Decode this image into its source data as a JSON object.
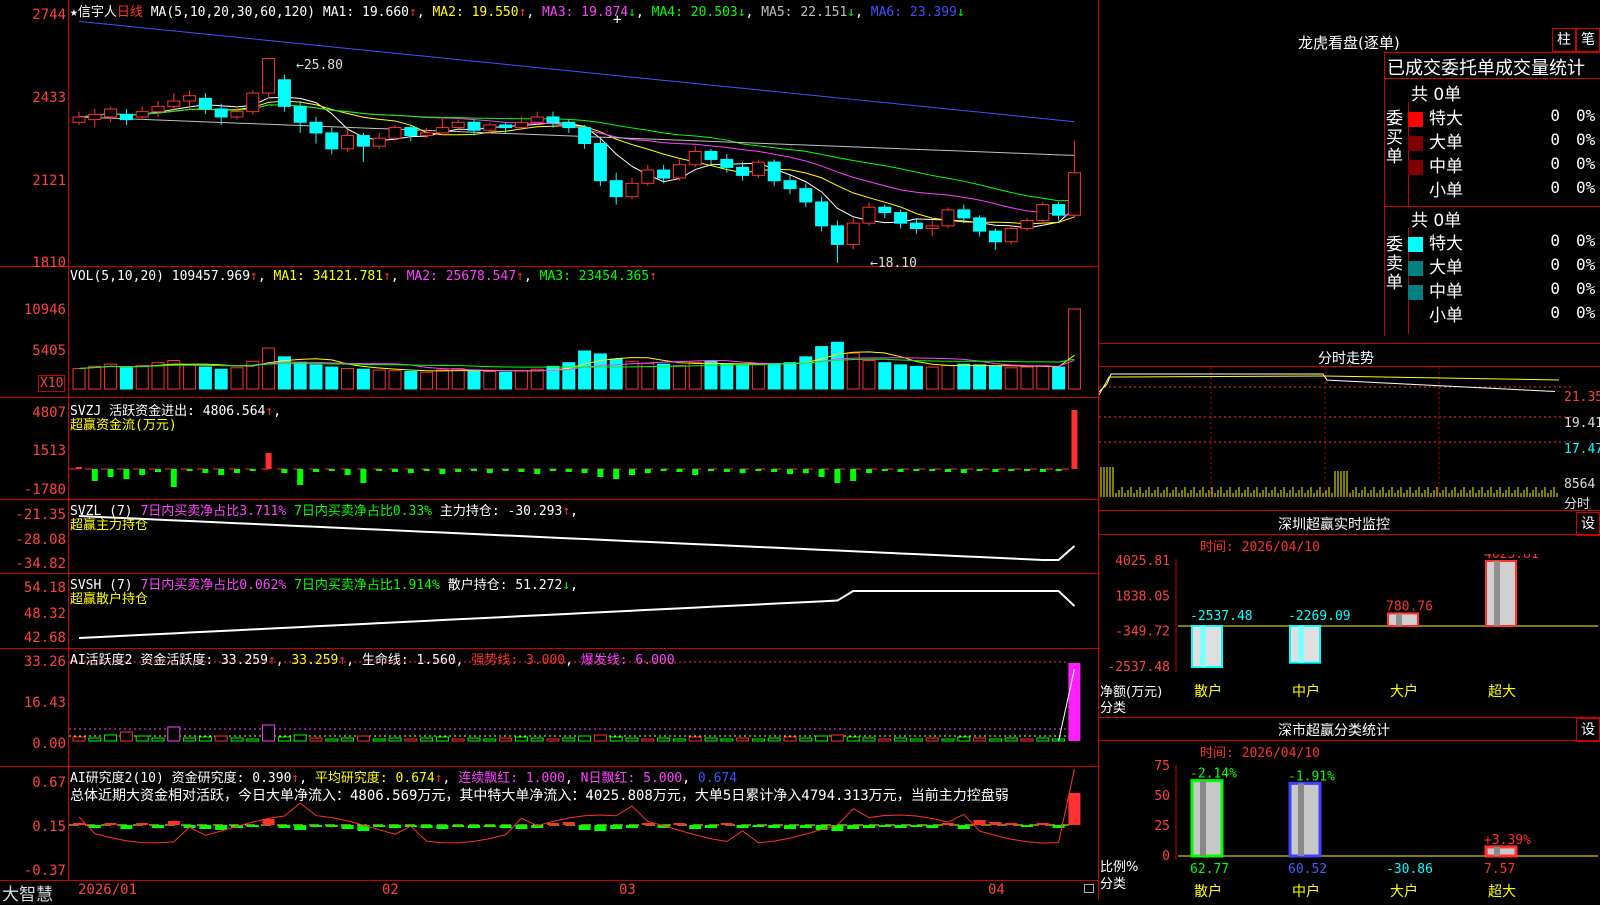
{
  "main": {
    "star": "★",
    "stock_name": "信宇人",
    "period": "日线",
    "ma_params": "MA(5,10,20,30,60,120)",
    "ma": [
      {
        "label": "MA1: 19.660",
        "color": "#ffffff"
      },
      {
        "label": "MA2: 19.550",
        "color": "#ffff00"
      },
      {
        "label": "MA3: 19.874",
        "color": "#ff40ff"
      },
      {
        "label": "MA4: 20.503",
        "color": "#00ff00"
      },
      {
        "label": "MA5: 22.151",
        "color": "#c0c0c0"
      },
      {
        "label": "MA6: 23.399",
        "color": "#4050ff"
      }
    ],
    "y_ticks": [
      "2744",
      "2433",
      "2121",
      "1810"
    ],
    "high_label": "25.80",
    "low_label": "18.10"
  },
  "vol": {
    "params": "VOL(5,10,20)",
    "value": "109457.969",
    "ma1": "MA1: 34121.781",
    "ma2": "MA2: 25678.547",
    "ma3": "MA3: 23454.365",
    "y_ticks": [
      "10946",
      "5405"
    ],
    "unit": "X10"
  },
  "svzj": {
    "name": "SVZJ",
    "label": "活跃资金进出: 4806.564",
    "sub": "超赢资金流(万元)",
    "y_ticks": [
      "4807",
      "1513",
      "-1780"
    ]
  },
  "svzl": {
    "name": "SVZL (7)",
    "a": "7日内买卖净占比3.711%",
    "b": "7日内买卖净占比0.33%",
    "c": "主力持仓: -30.293",
    "sub": "超赢主力持仓",
    "y_ticks": [
      "-21.35",
      "-28.08",
      "-34.82"
    ]
  },
  "svsh": {
    "name": "SVSH (7)",
    "a": "7日内买卖净占比0.062%",
    "b": "7日内买卖净占比1.914%",
    "c": "散户持仓: 51.272",
    "sub": "超赢散户持仓",
    "y_ticks": [
      "54.18",
      "48.32",
      "42.68"
    ]
  },
  "ai1": {
    "name": "AI活跃度2",
    "a": "资金活跃度: 33.259",
    "b": "33.259",
    "c": "生命线: 1.560",
    "d": "强势线: 3.000",
    "e": "爆发线: 6.000",
    "y_ticks": [
      "33.26",
      "16.43",
      "0.00"
    ]
  },
  "ai2": {
    "name": "AI研究度2(10)",
    "a": "资金研究度: 0.390",
    "b": "平均研究度: 0.674",
    "c": "连续飘红: 1.000",
    "d": "N日飘红: 5.000",
    "e": "0.674",
    "summary": "总体近期大资金相对活跃，今日大单净流入：4806.569万元，其中特大单净流入：4025.808万元，大单5日累计净入4794.313万元，当前主力控盘弱",
    "y_ticks": [
      "0.67",
      "0.15",
      "-0.37"
    ]
  },
  "bottom": {
    "brand": "大智慧",
    "months": [
      "2026/01",
      "02",
      "03",
      "04"
    ]
  },
  "dragon": {
    "title": "龙虎看盘(逐单)",
    "btn1": "柱",
    "btn2": "笔",
    "tabs": "已成交委托单成交量统计",
    "buy_total": "共 0单",
    "sell_total": "共 0单",
    "buy_label": "委买单",
    "sell_label": "委卖单",
    "rows": [
      {
        "name": "特大",
        "n": "0",
        "p": "0%"
      },
      {
        "name": "大单",
        "n": "0",
        "p": "0%"
      },
      {
        "name": "中单",
        "n": "0",
        "p": "0%"
      },
      {
        "name": "小单",
        "n": "0",
        "p": "0%"
      }
    ]
  },
  "intraday": {
    "title": "分时走势",
    "ticks": [
      "21.35",
      "19.41",
      "17.47",
      "8564"
    ],
    "unit": "分时"
  },
  "sz_monitor": {
    "title": "深圳超赢实时监控",
    "btn": "设",
    "time": "时间: 2026/04/10",
    "y_ticks": [
      "4025.81",
      "1838.05",
      "-349.72",
      "-2537.48"
    ],
    "ylabel": "净额(万元)",
    "xlabel": "分类",
    "cats": [
      "散户",
      "中户",
      "大户",
      "超大"
    ],
    "values": [
      "-2537.48",
      "-2269.09",
      "780.76",
      "4025.81"
    ]
  },
  "sz_class": {
    "title": "深市超赢分类统计",
    "btn": "设",
    "time": "时间: 2026/04/10",
    "y_ticks": [
      "75",
      "50",
      "25",
      "0"
    ],
    "ylabel": "比例%",
    "xlabel": "分类",
    "cats": [
      "散户",
      "中户",
      "大户",
      "超大"
    ],
    "tops": [
      "-2.14%",
      "-1.91%",
      "",
      "+3.39%"
    ],
    "values": [
      "62.77",
      "60.52",
      "-30.86",
      "7.57"
    ]
  },
  "chart_data": {
    "type": "candlestick",
    "title": "信宇人 日线",
    "ylim": [
      18.1,
      27.44
    ],
    "candles": [
      [
        23.4,
        23.6,
        23.3,
        23.8
      ],
      [
        23.5,
        23.7,
        23.2,
        23.9
      ],
      [
        23.6,
        23.9,
        23.4,
        24.0
      ],
      [
        23.7,
        23.5,
        23.3,
        23.9
      ],
      [
        23.6,
        23.8,
        23.5,
        24.0
      ],
      [
        23.8,
        24.0,
        23.6,
        24.2
      ],
      [
        24.0,
        24.2,
        23.8,
        24.5
      ],
      [
        24.2,
        24.4,
        23.9,
        24.6
      ],
      [
        24.3,
        23.9,
        23.7,
        24.5
      ],
      [
        23.9,
        23.6,
        23.3,
        24.1
      ],
      [
        23.6,
        23.8,
        23.5,
        24.0
      ],
      [
        23.8,
        24.5,
        23.7,
        24.6
      ],
      [
        24.5,
        25.8,
        24.3,
        25.8
      ],
      [
        25.0,
        24.0,
        23.8,
        25.2
      ],
      [
        24.0,
        23.4,
        23.0,
        24.2
      ],
      [
        23.4,
        23.0,
        22.6,
        23.6
      ],
      [
        23.0,
        22.4,
        22.2,
        23.2
      ],
      [
        22.4,
        22.9,
        22.3,
        23.1
      ],
      [
        22.9,
        22.5,
        21.9,
        23.0
      ],
      [
        22.5,
        22.8,
        22.4,
        23.0
      ],
      [
        22.8,
        23.2,
        22.7,
        23.3
      ],
      [
        23.2,
        22.9,
        22.7,
        23.3
      ],
      [
        22.9,
        23.0,
        22.8,
        23.2
      ],
      [
        23.0,
        23.2,
        22.9,
        23.6
      ],
      [
        23.2,
        23.4,
        23.1,
        23.5
      ],
      [
        23.4,
        23.1,
        22.9,
        23.5
      ],
      [
        23.1,
        23.3,
        23.0,
        23.4
      ],
      [
        23.3,
        23.2,
        23.0,
        23.4
      ],
      [
        23.2,
        23.4,
        23.1,
        23.6
      ],
      [
        23.4,
        23.6,
        23.3,
        23.8
      ],
      [
        23.6,
        23.4,
        23.2,
        23.8
      ],
      [
        23.4,
        23.2,
        23.0,
        23.5
      ],
      [
        23.2,
        22.6,
        22.4,
        23.3
      ],
      [
        22.6,
        21.2,
        21.0,
        22.8
      ],
      [
        21.2,
        20.6,
        20.3,
        21.5
      ],
      [
        20.6,
        21.1,
        20.5,
        21.3
      ],
      [
        21.1,
        21.6,
        21.0,
        21.8
      ],
      [
        21.6,
        21.3,
        21.1,
        21.8
      ],
      [
        21.3,
        21.8,
        21.2,
        22.0
      ],
      [
        21.8,
        22.3,
        21.7,
        22.5
      ],
      [
        22.3,
        22.0,
        21.8,
        22.4
      ],
      [
        22.0,
        21.7,
        21.5,
        22.2
      ],
      [
        21.7,
        21.4,
        21.2,
        21.9
      ],
      [
        21.4,
        21.9,
        21.3,
        22.0
      ],
      [
        21.9,
        21.2,
        21.0,
        22.0
      ],
      [
        21.2,
        20.9,
        20.7,
        21.4
      ],
      [
        20.9,
        20.4,
        20.2,
        21.1
      ],
      [
        20.4,
        19.5,
        19.3,
        20.6
      ],
      [
        19.5,
        18.8,
        18.1,
        19.7
      ],
      [
        18.8,
        19.6,
        18.6,
        19.8
      ],
      [
        19.6,
        20.2,
        19.5,
        20.4
      ],
      [
        20.2,
        20.0,
        19.8,
        20.3
      ],
      [
        20.0,
        19.6,
        19.4,
        20.1
      ],
      [
        19.6,
        19.4,
        19.2,
        19.8
      ],
      [
        19.4,
        19.5,
        19.1,
        19.7
      ],
      [
        19.5,
        20.1,
        19.4,
        20.2
      ],
      [
        20.1,
        19.8,
        19.6,
        20.3
      ],
      [
        19.8,
        19.3,
        19.1,
        19.9
      ],
      [
        19.3,
        18.9,
        18.6,
        19.4
      ],
      [
        18.9,
        19.4,
        18.8,
        19.5
      ],
      [
        19.4,
        19.7,
        19.3,
        19.8
      ],
      [
        19.7,
        20.3,
        19.6,
        20.4
      ],
      [
        20.3,
        19.9,
        19.7,
        20.4
      ],
      [
        19.9,
        21.5,
        19.8,
        22.7
      ]
    ],
    "volume_x10": [
      2800,
      3100,
      3400,
      2900,
      3200,
      3600,
      3900,
      3300,
      3000,
      2700,
      2900,
      3800,
      5600,
      4400,
      3600,
      3300,
      3000,
      2800,
      2700,
      2600,
      2500,
      2400,
      2300,
      2600,
      2800,
      2500,
      2400,
      2300,
      2500,
      2700,
      3100,
      3600,
      5200,
      4800,
      4100,
      3800,
      3500,
      3400,
      3200,
      3600,
      3800,
      3400,
      3200,
      3300,
      3500,
      3600,
      4400,
      5800,
      6400,
      4900,
      3900,
      3600,
      3300,
      3100,
      3000,
      3200,
      3400,
      3300,
      3100,
      2900,
      3000,
      3200,
      3000,
      10946
    ]
  }
}
